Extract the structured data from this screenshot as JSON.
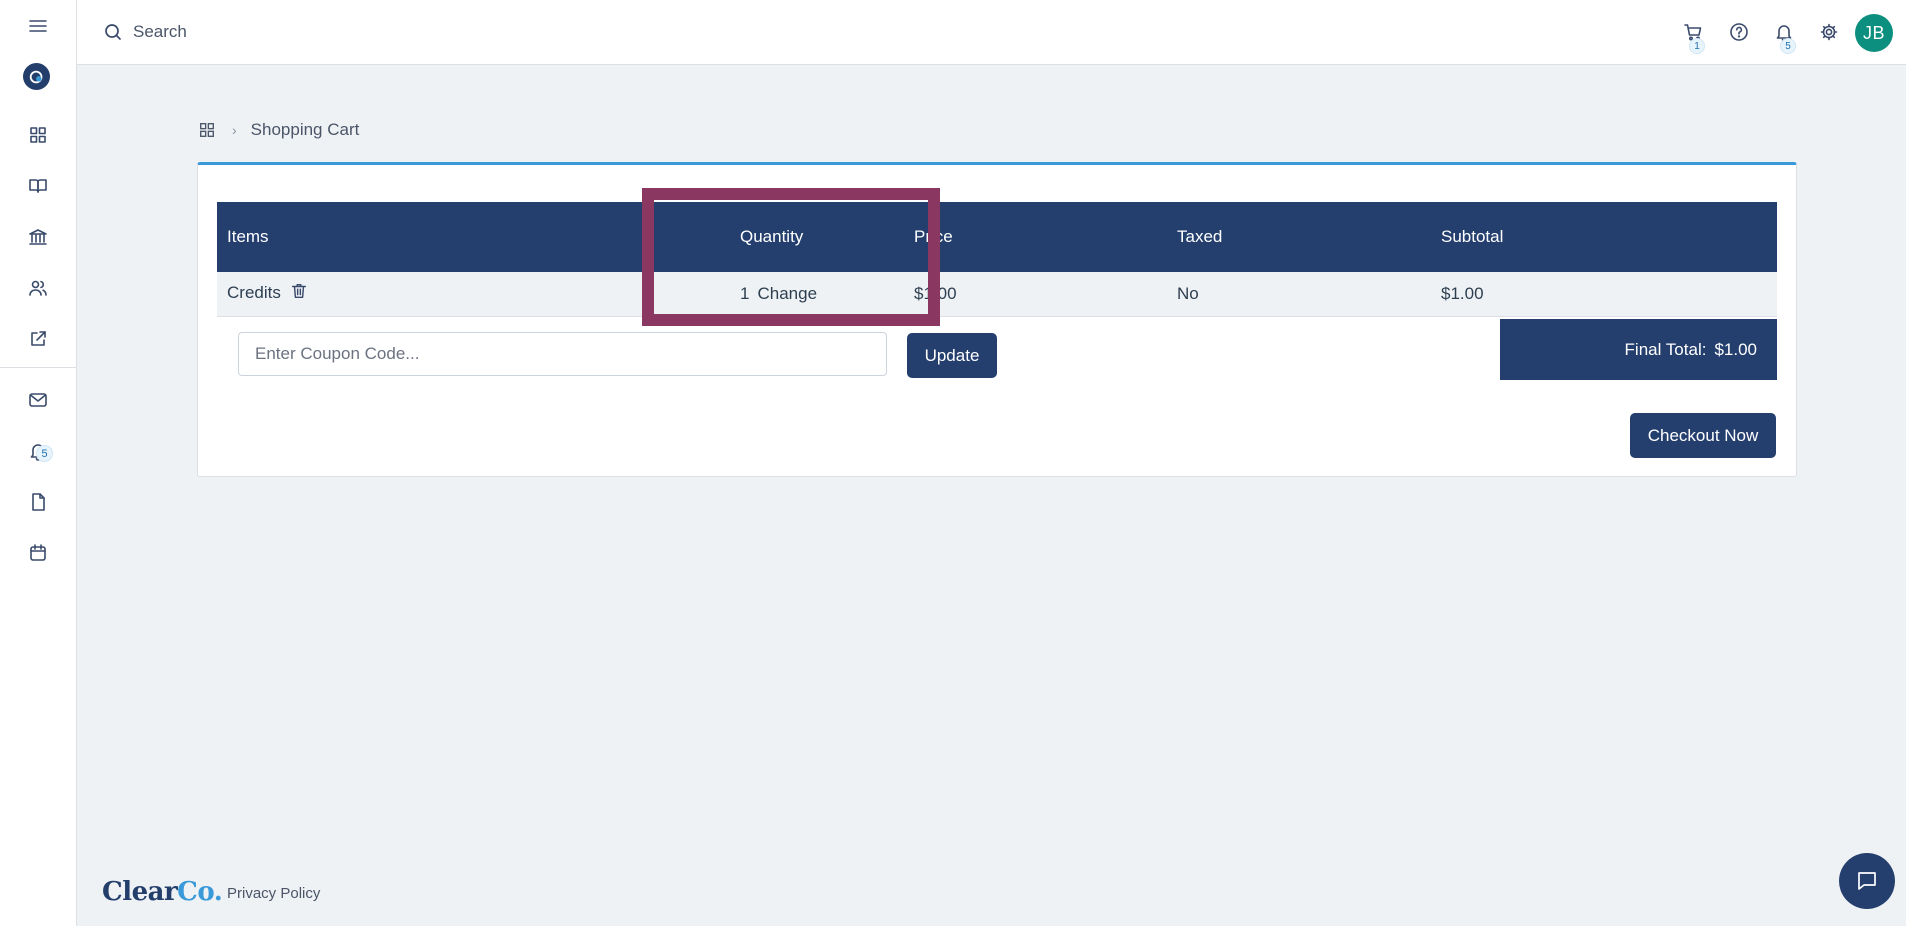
{
  "sidebar": {
    "items": [
      {
        "icon": "menu-icon"
      },
      {
        "icon": "app-logo-icon"
      },
      {
        "icon": "dashboard-grid-icon"
      },
      {
        "icon": "book-icon"
      },
      {
        "icon": "bank-icon"
      },
      {
        "icon": "users-icon"
      },
      {
        "icon": "external-link-icon"
      },
      {
        "icon": "mail-icon"
      },
      {
        "icon": "bell-icon",
        "badge": "5"
      },
      {
        "icon": "document-icon"
      },
      {
        "icon": "calendar-icon"
      }
    ]
  },
  "topbar": {
    "search_placeholder": "Search",
    "cart_badge": "1",
    "notifications_badge": "5",
    "avatar_initials": "JB"
  },
  "breadcrumb": {
    "current": "Shopping Cart"
  },
  "cart": {
    "columns": [
      "Items",
      "Quantity",
      "Price",
      "Taxed",
      "Subtotal"
    ],
    "rows": [
      {
        "item": "Credits",
        "quantity": "1",
        "change_label": "Change",
        "price": "$1.00",
        "taxed": "No",
        "subtotal": "$1.00"
      }
    ],
    "coupon_placeholder": "Enter Coupon Code...",
    "update_label": "Update",
    "final_total_label": "Final Total:",
    "final_total_value": "$1.00",
    "checkout_label": "Checkout Now"
  },
  "footer": {
    "logo_main": "Clear",
    "logo_accent": "Co.",
    "privacy_label": "Privacy Policy"
  },
  "colors": {
    "primary": "#243f6e",
    "accent": "#3a9ad9",
    "highlight": "#8a3762",
    "avatar": "#0c8f7f"
  }
}
